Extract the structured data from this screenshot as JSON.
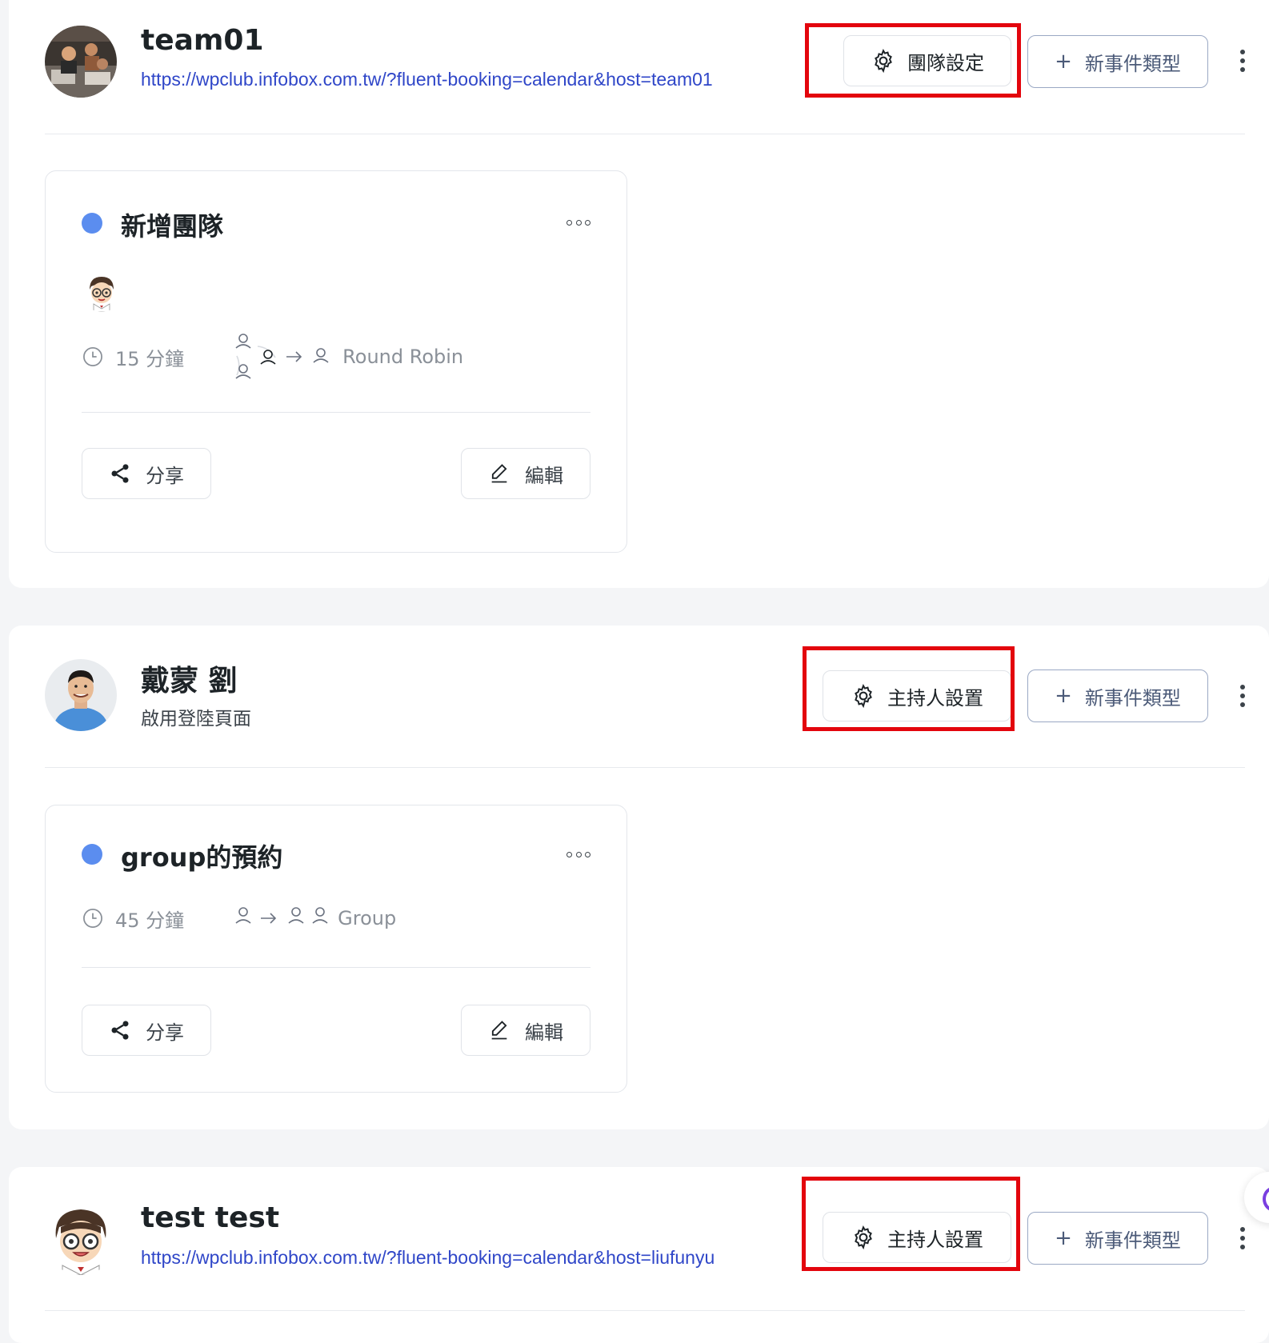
{
  "hosts": [
    {
      "name": "team01",
      "link": "https://wpclub.infobox.com.tw/?fluent-booking=calendar&host=team01",
      "settings_label": "團隊設定",
      "new_event_label": "新事件類型",
      "event": {
        "title": "新增團隊",
        "duration": "15 分鐘",
        "mode": "Round Robin"
      }
    },
    {
      "name": "戴蒙 劉",
      "subtitle": "啟用登陸頁面",
      "settings_label": "主持人設置",
      "new_event_label": "新事件類型",
      "event": {
        "title": "group的預約",
        "duration": "45 分鐘",
        "mode": "Group"
      }
    },
    {
      "name": "test test",
      "link": "https://wpclub.infobox.com.tw/?fluent-booking=calendar&host=liufunyu",
      "settings_label": "主持人設置",
      "new_event_label": "新事件類型"
    }
  ],
  "card_actions": {
    "share_label": "分享",
    "edit_label": "編輯"
  },
  "colors": {
    "link": "#2f46c8",
    "event_dot": "#5b8def",
    "highlight": "#e3050d"
  }
}
